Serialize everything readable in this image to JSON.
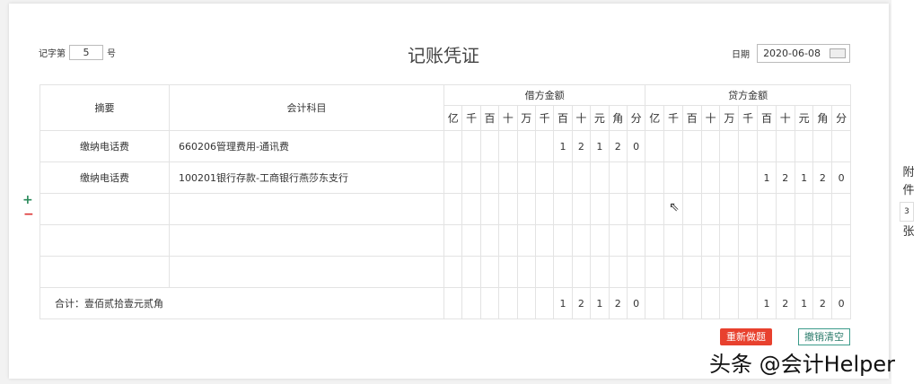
{
  "voucher": {
    "prefix": "记字第",
    "number": "5",
    "suffix": "号",
    "title": "记账凭证",
    "date_label": "日期",
    "date": "2020-06-08"
  },
  "table": {
    "col_summary": "摘要",
    "col_account": "会计科目",
    "col_debit": "借方金额",
    "col_credit": "贷方金额",
    "units": [
      "亿",
      "千",
      "百",
      "十",
      "万",
      "千",
      "百",
      "十",
      "元",
      "角",
      "分"
    ],
    "rows": [
      {
        "summary": "缴纳电话费",
        "account": "660206管理费用-通讯费",
        "debit": [
          "",
          "",
          "",
          "",
          "",
          "",
          "1",
          "2",
          "1",
          "2",
          "0"
        ],
        "credit": [
          "",
          "",
          "",
          "",
          "",
          "",
          "",
          "",
          "",
          "",
          ""
        ]
      },
      {
        "summary": "缴纳电话费",
        "account": "100201银行存款-工商银行燕莎东支行",
        "debit": [
          "",
          "",
          "",
          "",
          "",
          "",
          "",
          "",
          "",
          "",
          ""
        ],
        "credit": [
          "",
          "",
          "",
          "",
          "",
          "",
          "1",
          "2",
          "1",
          "2",
          "0"
        ]
      },
      {
        "summary": "",
        "account": "",
        "debit": [
          "",
          "",
          "",
          "",
          "",
          "",
          "",
          "",
          "",
          "",
          ""
        ],
        "credit": [
          "",
          "",
          "",
          "",
          "",
          "",
          "",
          "",
          "",
          "",
          ""
        ]
      },
      {
        "summary": "",
        "account": "",
        "debit": [
          "",
          "",
          "",
          "",
          "",
          "",
          "",
          "",
          "",
          "",
          ""
        ],
        "credit": [
          "",
          "",
          "",
          "",
          "",
          "",
          "",
          "",
          "",
          "",
          ""
        ]
      },
      {
        "summary": "",
        "account": "",
        "debit": [
          "",
          "",
          "",
          "",
          "",
          "",
          "",
          "",
          "",
          "",
          ""
        ],
        "credit": [
          "",
          "",
          "",
          "",
          "",
          "",
          "",
          "",
          "",
          "",
          ""
        ]
      }
    ],
    "total_label": "合计：壹佰贰拾壹元贰角",
    "total_debit": [
      "",
      "",
      "",
      "",
      "",
      "",
      "1",
      "2",
      "1",
      "2",
      "0"
    ],
    "total_credit": [
      "",
      "",
      "",
      "",
      "",
      "",
      "1",
      "2",
      "1",
      "2",
      "0"
    ]
  },
  "controls": {
    "add_row": "+",
    "remove_row": "−",
    "redo": "重新做题",
    "clear": "撤销清空"
  },
  "attachments": {
    "label_top": "附",
    "label_mid": "件",
    "count": "3",
    "label_bottom": "张"
  },
  "watermark": "头条 @会计Helper"
}
